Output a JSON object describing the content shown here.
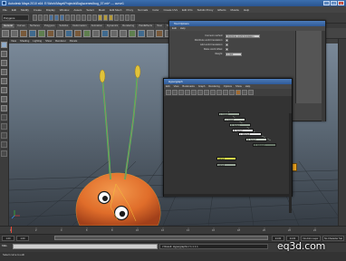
{
  "window": {
    "title": "Autodesk Maya 2010 x64: E:\\Work\\Maya\\Projects\\Bug\\scenes\\bug_07.mb* --- curve1"
  },
  "menubar": {
    "items": [
      "File",
      "Edit",
      "Modify",
      "Create",
      "Display",
      "Window",
      "Assets",
      "Select",
      "Mesh",
      "Edit Mesh",
      "Proxy",
      "Normals",
      "Color",
      "Create UVs",
      "Edit UVs",
      "Help",
      "Subdiv Proxy",
      "Effects",
      "Muscle",
      "Help"
    ]
  },
  "statusline": {
    "mode": "Polygons"
  },
  "shelf": {
    "tabs": [
      "General",
      "Curves",
      "Surfaces",
      "Polygons",
      "Subdivs",
      "Deformation",
      "Animation",
      "Dynamics",
      "Rendering",
      "PaintEffects",
      "Toon",
      "Muscle",
      "Fluids",
      "Fur",
      "Hair",
      "nCloth",
      "Custom"
    ]
  },
  "viewport": {
    "menu": [
      "View",
      "Shading",
      "Lighting",
      "Show",
      "Renderer",
      "Panels"
    ]
  },
  "tool_options": {
    "title": "Tool Options",
    "menu": [
      "Edit",
      "Help"
    ],
    "rows": [
      {
        "label": "Connect method:",
        "value": "Distribute world translation"
      },
      {
        "label": "Distribute world translation:",
        "value": ""
      },
      {
        "label": "Add world translation:",
        "value": ""
      },
      {
        "label": "Make world offset:",
        "value": ""
      },
      {
        "label": "Weight:",
        "value": "1.000"
      }
    ]
  },
  "hypergraph": {
    "title": "Hypergraph",
    "menu": [
      "Edit",
      "View",
      "Bookmarks",
      "Graph",
      "Rendering",
      "Options",
      "Show",
      "Help"
    ],
    "nodes": [
      {
        "label": "L_bone1"
      },
      {
        "label": "L_bone2"
      },
      {
        "label": "R_bone1"
      },
      {
        "label": "R_bone2"
      },
      {
        "label": "L_ikbone3"
      },
      {
        "label": "R_bone3"
      },
      {
        "label": "R_ikbone3"
      },
      {
        "label": "curve1"
      },
      {
        "label": "curve2"
      }
    ]
  },
  "timeline": {
    "ticks": [
      "1",
      "2",
      "4",
      "6",
      "8",
      "10",
      "12",
      "14",
      "16",
      "18",
      "20",
      "22",
      "24"
    ]
  },
  "range": {
    "start": "1.00",
    "start_in": "1.00",
    "end_in": "24.00",
    "end": "24.00",
    "no_anim_layer": "No Anim Layer",
    "no_char_set": "No Character Set"
  },
  "command": {
    "label": "MEL",
    "result": "// Result: Hypergraph1 // 1 1 1 1"
  },
  "helpline": {
    "text": "Select curve to edit"
  },
  "watermark": {
    "text": "eq3d.com"
  },
  "colors": {
    "maya_blue": "#3b6fae",
    "node_selected": "#d8e04a",
    "orange_key": "#e9a11f",
    "bug_body": "#e06d2a"
  }
}
